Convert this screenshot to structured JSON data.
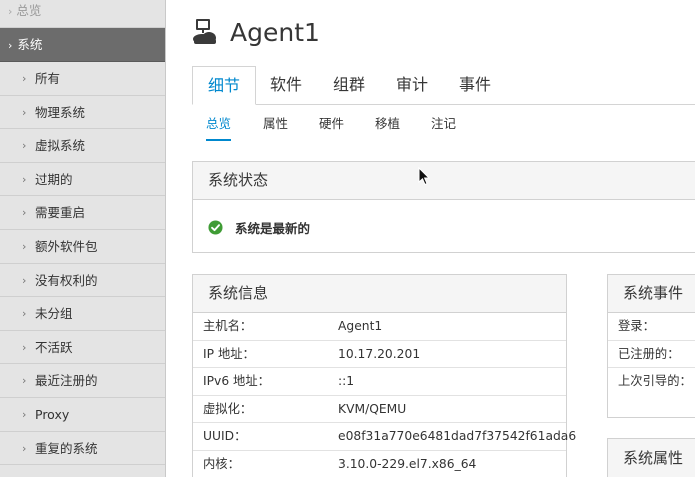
{
  "sidebar": {
    "top_partial": "总览",
    "active": "系统",
    "items": [
      {
        "label": "所有"
      },
      {
        "label": "物理系统"
      },
      {
        "label": "虚拟系统"
      },
      {
        "label": "过期的"
      },
      {
        "label": "需要重启"
      },
      {
        "label": "额外软件包"
      },
      {
        "label": "没有权利的"
      },
      {
        "label": "未分组"
      },
      {
        "label": "不活跃"
      },
      {
        "label": "最近注册的"
      },
      {
        "label": "Proxy"
      },
      {
        "label": "重复的系统"
      }
    ]
  },
  "header": {
    "title": "Agent1",
    "icon": "system-server-icon"
  },
  "tabs": [
    {
      "label": "细节",
      "active": true
    },
    {
      "label": "软件",
      "active": false
    },
    {
      "label": "组群",
      "active": false
    },
    {
      "label": "审计",
      "active": false
    },
    {
      "label": "事件",
      "active": false
    }
  ],
  "subtabs": [
    {
      "label": "总览",
      "active": true
    },
    {
      "label": "属性",
      "active": false
    },
    {
      "label": "硬件",
      "active": false
    },
    {
      "label": "移植",
      "active": false
    },
    {
      "label": "注记",
      "active": false
    }
  ],
  "status_panel": {
    "title": "系统状态",
    "message": "系统是最新的",
    "status_color": "#3f9c35"
  },
  "info_panel": {
    "title": "系统信息",
    "rows": [
      {
        "key": "主机名：",
        "value": "Agent1"
      },
      {
        "key": "IP 地址：",
        "value": "10.17.20.201"
      },
      {
        "key": "IPv6 地址：",
        "value": "::1"
      },
      {
        "key": "虚拟化：",
        "value": "KVM/QEMU"
      },
      {
        "key": "UUID：",
        "value": "e08f31a770e6481dad7f37542f61ada6"
      },
      {
        "key": "内核：",
        "value": "3.10.0-229.el7.x86_64"
      }
    ]
  },
  "events_panel": {
    "title": "系统事件",
    "rows": [
      {
        "key": "登录："
      },
      {
        "key": "已注册的："
      },
      {
        "key": "上次引导的："
      }
    ]
  },
  "props_panel": {
    "title": "系统属性"
  },
  "colors": {
    "accent": "#0088ce",
    "sidebar_active": "#6c6c6c",
    "sidebar_bg": "#e4e4e4"
  }
}
